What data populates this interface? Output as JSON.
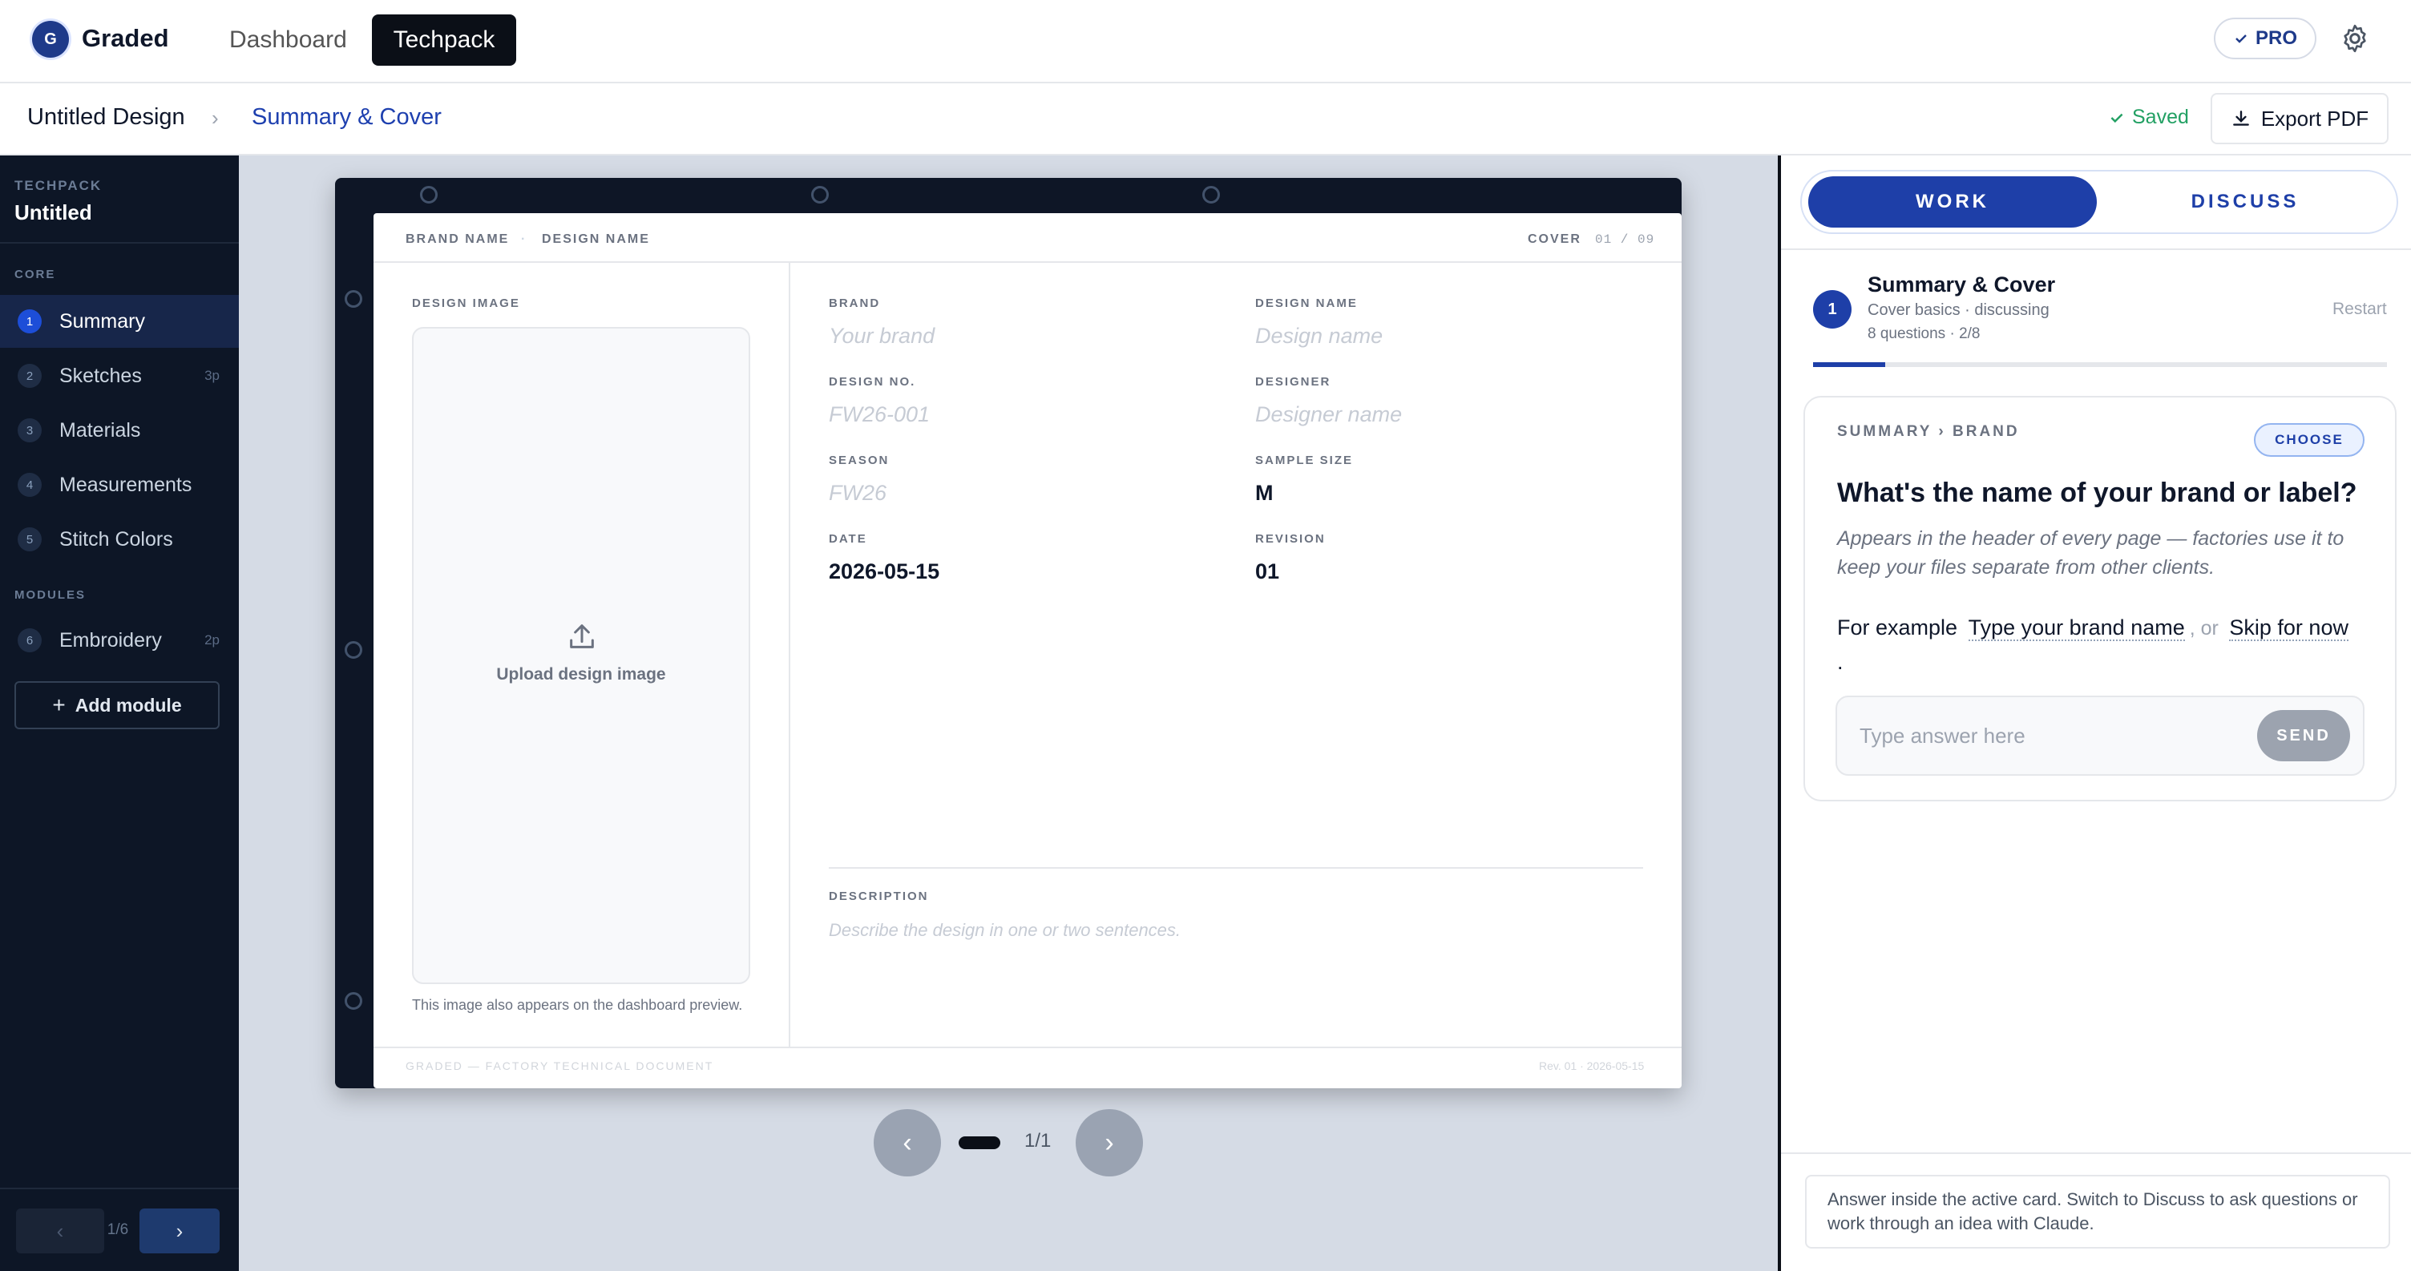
{
  "header": {
    "logo_letter": "G",
    "app_name": "Graded",
    "nav": {
      "dashboard": "Dashboard",
      "techpack": "Techpack"
    },
    "pro_label": "PRO"
  },
  "breadcrumb": {
    "design": "Untitled Design",
    "section": "Summary & Cover",
    "saved": "Saved",
    "export": "Export PDF"
  },
  "sidebar": {
    "techpack_label": "TECHPACK",
    "techpack_name": "Untitled",
    "core_label": "CORE",
    "core_items": [
      {
        "num": "1",
        "label": "Summary",
        "badge": ""
      },
      {
        "num": "2",
        "label": "Sketches",
        "badge": "3p"
      },
      {
        "num": "3",
        "label": "Materials",
        "badge": ""
      },
      {
        "num": "4",
        "label": "Measurements",
        "badge": ""
      },
      {
        "num": "5",
        "label": "Stitch Colors",
        "badge": ""
      }
    ],
    "modules_label": "MODULES",
    "module_items": [
      {
        "num": "6",
        "label": "Embroidery",
        "badge": "2p"
      }
    ],
    "add_module": "Add module",
    "page": "1/6"
  },
  "document": {
    "brand_name": "BRAND NAME",
    "design_name": "DESIGN NAME",
    "cover": "COVER",
    "page_of": "01 / 09",
    "design_image_label": "DESIGN IMAGE",
    "upload_label": "Upload design image",
    "image_note": "This image also appears on the dashboard preview.",
    "fields": {
      "brand": {
        "label": "BRAND",
        "placeholder": "Your brand"
      },
      "design_name": {
        "label": "DESIGN NAME",
        "placeholder": "Design name"
      },
      "design_no": {
        "label": "DESIGN NO.",
        "placeholder": "FW26-001"
      },
      "designer": {
        "label": "DESIGNER",
        "placeholder": "Designer name"
      },
      "season": {
        "label": "SEASON",
        "placeholder": "FW26"
      },
      "sample_size": {
        "label": "SAMPLE SIZE",
        "value": "M"
      },
      "date": {
        "label": "DATE",
        "value": "2026-05-15"
      },
      "revision": {
        "label": "REVISION",
        "value": "01"
      }
    },
    "description_label": "DESCRIPTION",
    "description_placeholder": "Describe the design in one or two sentences.",
    "footer_left": "GRADED — FACTORY TECHNICAL DOCUMENT",
    "footer_right": "Rev. 01 · 2026-05-15"
  },
  "pager": {
    "text": "1/1"
  },
  "panel": {
    "tabs": {
      "work": "WORK",
      "discuss": "DISCUSS"
    },
    "step": {
      "num": "1",
      "title": "Summary & Cover",
      "subtitle": "Cover basics · discussing",
      "meta": "8 questions · 2/8",
      "restart": "Restart",
      "progress": 0.125
    },
    "card": {
      "crumb": "SUMMARY › BRAND",
      "choose": "CHOOSE",
      "question": "What's the name of your brand or label?",
      "description": "Appears in the header of every page — factories use it to keep your files separate from other clients.",
      "example_prefix": "For example",
      "option1": "Type your brand name",
      "separator": ", or",
      "option2": "Skip for now",
      "period": ".",
      "answer_placeholder": "Type answer here",
      "send": "SEND"
    },
    "footer_note": "Answer inside the active card. Switch to Discuss to ask questions or work through an idea with Claude."
  },
  "colors": {
    "accent": "#1e3fa8",
    "sidebar_bg": "#0d1626",
    "saved_green": "#22a063"
  },
  "icons": [
    "gear-icon",
    "check-icon",
    "download-icon",
    "chevron-right-icon",
    "upload-icon",
    "plus-icon",
    "chevron-left-icon"
  ]
}
